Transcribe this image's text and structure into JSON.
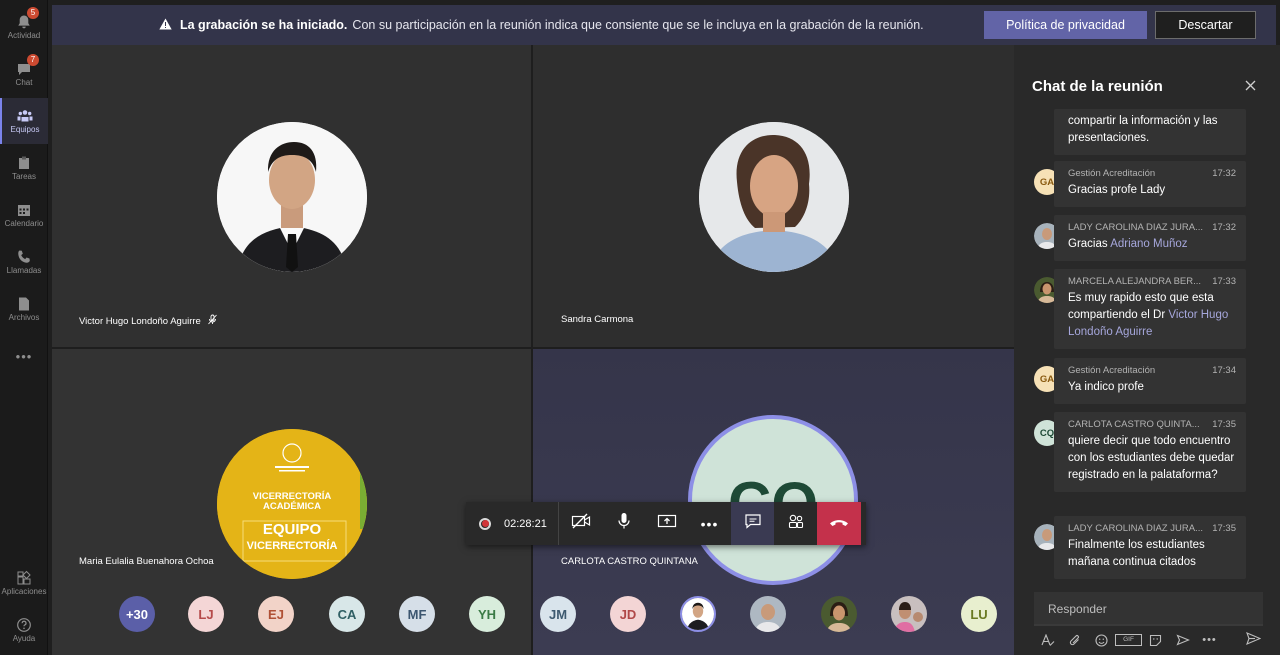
{
  "rail": {
    "items": [
      {
        "label": "Actividad",
        "icon": "bell-icon",
        "badge": "5"
      },
      {
        "label": "Chat",
        "icon": "chat-icon",
        "badge": "7"
      },
      {
        "label": "Equipos",
        "icon": "teams-icon",
        "badge": ""
      },
      {
        "label": "Tareas",
        "icon": "tasks-icon",
        "badge": ""
      },
      {
        "label": "Calendario",
        "icon": "calendar-icon",
        "badge": ""
      },
      {
        "label": "Llamadas",
        "icon": "phone-icon",
        "badge": ""
      },
      {
        "label": "Archivos",
        "icon": "files-icon",
        "badge": ""
      }
    ],
    "more": "•••",
    "apps_label": "Aplicaciones",
    "help_label": "Ayuda"
  },
  "banner": {
    "bold": "La grabación se ha iniciado.",
    "text": "Con su participación en la reunión indica que consiente que se le incluya en la grabación de la reunión.",
    "policy_button": "Política de privacidad",
    "dismiss_button": "Descartar"
  },
  "tiles": [
    {
      "name": "Victor Hugo Londoño Aguirre"
    },
    {
      "name": "Sandra Carmona"
    },
    {
      "name": "Maria Eulalia Buenahora Ochoa",
      "logo_lines": [
        "VICERRECTORÍA",
        "ACADÉMICA",
        "EQUIPO",
        "VICERRECTORÍA"
      ]
    },
    {
      "name": "CARLOTA CASTRO QUINTANA",
      "initials": "CQ"
    }
  ],
  "controls": {
    "timer": "02:28:21",
    "more": "•••"
  },
  "participants": [
    {
      "label": "+30",
      "bg": "#5b5fa8",
      "fg": "#ffffff"
    },
    {
      "label": "LJ",
      "bg": "#f4d6d6",
      "fg": "#b54a4a"
    },
    {
      "label": "EJ",
      "bg": "#f2d3c8",
      "fg": "#b05035"
    },
    {
      "label": "CA",
      "bg": "#d8e7e8",
      "fg": "#2f5f64"
    },
    {
      "label": "MF",
      "bg": "#d6dfe8",
      "fg": "#3c5670"
    },
    {
      "label": "YH",
      "bg": "#d8eddc",
      "fg": "#3a7a46"
    },
    {
      "label": "JM",
      "bg": "#d9e4ec",
      "fg": "#3e5a70"
    },
    {
      "label": "JD",
      "bg": "#f3d5d5",
      "fg": "#b04848"
    },
    {
      "label": "",
      "bg": "#ffffff",
      "fg": "#000000"
    },
    {
      "label": "",
      "bg": "#9aa7b2",
      "fg": "#000000"
    },
    {
      "label": "",
      "bg": "#6b5a3a",
      "fg": "#000000"
    },
    {
      "label": "",
      "bg": "#8a7070",
      "fg": "#000000"
    },
    {
      "label": "LU",
      "bg": "#e8efcf",
      "fg": "#6a7a22"
    }
  ],
  "chat": {
    "title": "Chat de la reunión",
    "messages": [
      {
        "author": "",
        "time": "",
        "text": "compartir la información y las presentaciones."
      },
      {
        "author": "Gestión Acreditación",
        "time": "17:32",
        "text": "Gracias profe Lady",
        "initials": "GA"
      },
      {
        "author": "LADY CAROLINA DIAZ JURA...",
        "time": "17:32",
        "text": "Gracias ",
        "mention": "Adriano Muñoz"
      },
      {
        "author": "MARCELA ALEJANDRA BER...",
        "time": "17:33",
        "text": "Es muy rapido esto que esta compartiendo el Dr ",
        "mention": "Victor Hugo Londoño Aguirre"
      },
      {
        "author": "Gestión Acreditación",
        "time": "17:34",
        "text": "Ya indico profe",
        "initials": "GA"
      },
      {
        "author": "CARLOTA CASTRO QUINTA...",
        "time": "17:35",
        "text": "quiere decir que todo encuentro con los estudiantes debe quedar registrado en la palataforma?",
        "initials": "CQ"
      },
      {
        "author": "LADY CAROLINA DIAZ JURA...",
        "time": "17:35",
        "text": "Finalmente los estudiantes mañana continua citados"
      }
    ],
    "reply_placeholder": "Responder",
    "toolbar": [
      "format-icon",
      "attach-icon",
      "emoji-icon",
      "gif-icon",
      "sticker-icon",
      "meet-icon",
      "more-icon"
    ],
    "gif_label": "GIF"
  }
}
